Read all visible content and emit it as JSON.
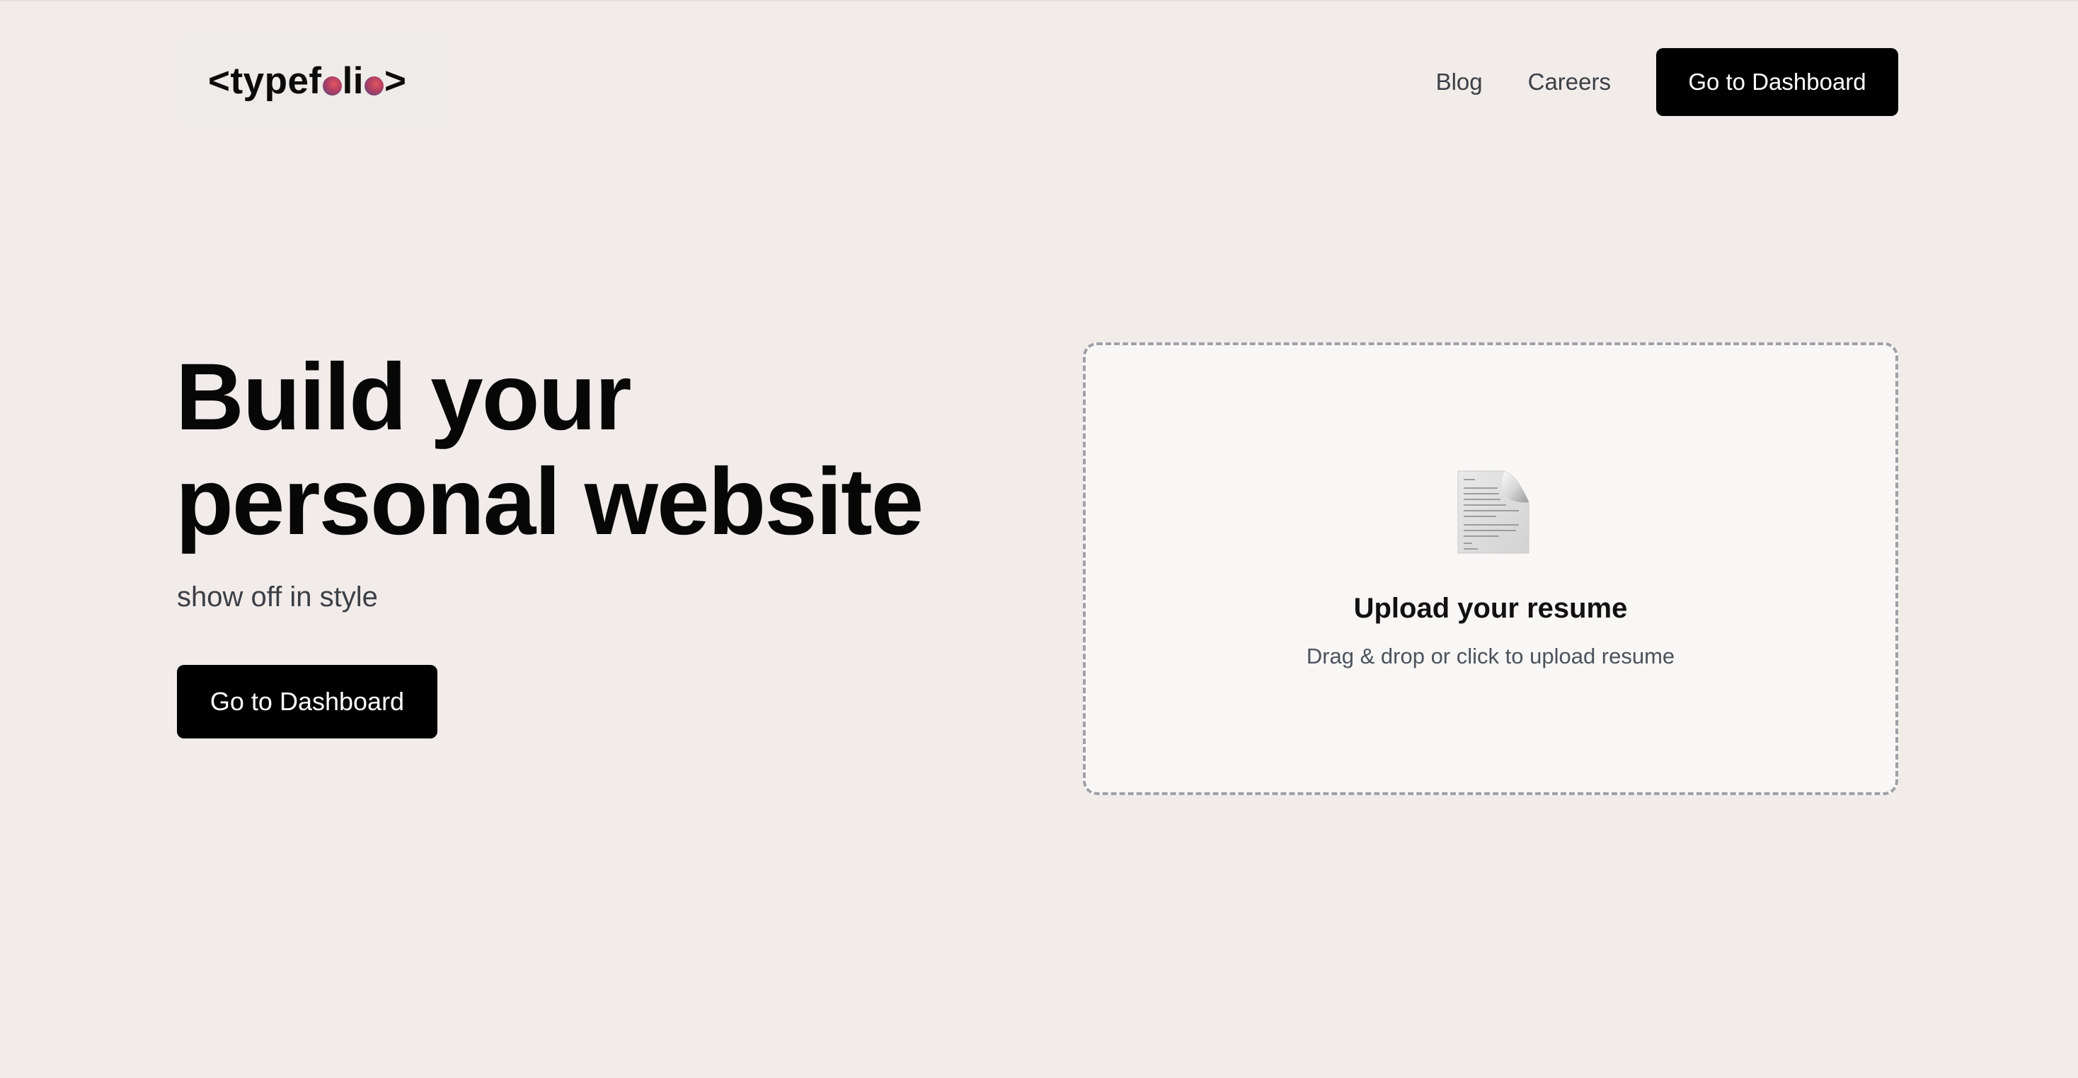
{
  "header": {
    "logo_prefix": "<typef",
    "logo_middle": "li",
    "logo_suffix": ">",
    "nav": {
      "blog": "Blog",
      "careers": "Careers",
      "dashboard_button": "Go to Dashboard"
    }
  },
  "hero": {
    "title_line1": "Build your",
    "title_line2": "personal website",
    "subtitle": "show off in style",
    "cta_button": "Go to Dashboard"
  },
  "upload": {
    "title": "Upload your resume",
    "subtitle": "Drag & drop or click to upload resume",
    "icon": "document-icon"
  },
  "colors": {
    "background": "#f1ece9",
    "button": "#000000",
    "upload_border": "#a0a0a8"
  }
}
